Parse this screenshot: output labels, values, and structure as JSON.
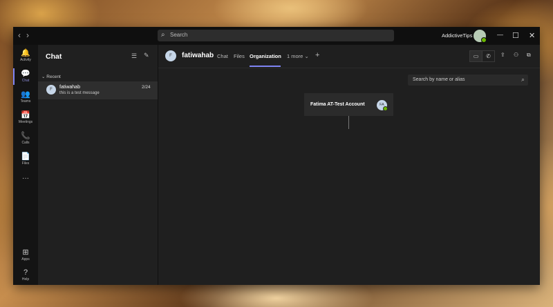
{
  "titlebar": {
    "search_placeholder": "Search",
    "user_name": "AddictiveTips",
    "nav_back": "‹",
    "nav_forward": "›",
    "minimize": "—",
    "maximize": "☐",
    "close": "✕"
  },
  "rail": [
    {
      "label": "Activity",
      "icon": "🔔"
    },
    {
      "label": "Chat",
      "icon": "💬"
    },
    {
      "label": "Teams",
      "icon": "👥"
    },
    {
      "label": "Meetings",
      "icon": "📅"
    },
    {
      "label": "Calls",
      "icon": "📞"
    },
    {
      "label": "Files",
      "icon": "📄"
    },
    {
      "label": "Apps",
      "icon": "⊞"
    },
    {
      "label": "Help",
      "icon": "?"
    }
  ],
  "rail_more": "···",
  "chatlist": {
    "title": "Chat",
    "section": "Recent",
    "items": [
      {
        "initial": "F",
        "name": "fatiwahab",
        "message": "this is a test message",
        "date": "2/24"
      }
    ]
  },
  "main": {
    "avatar_initial": "F",
    "contact_name": "fatiwahab",
    "tabs": [
      "Chat",
      "Files",
      "Organization",
      "1 more"
    ],
    "add_tab": "+",
    "org_search_placeholder": "Search by name or alias",
    "card": {
      "name": "Fatima AT-Test Account",
      "initials": "FA"
    }
  },
  "colors": {
    "accent": "#7f85f5",
    "presence": "#6bb700"
  }
}
